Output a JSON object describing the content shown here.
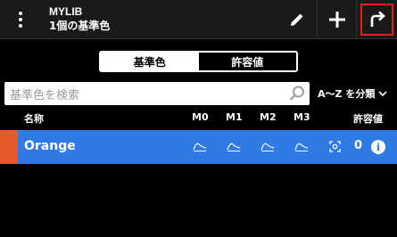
{
  "header": {
    "library": "MYLIB",
    "subtitle": "1個の基準色"
  },
  "segments": {
    "standard": "基準色",
    "tolerance": "許容値",
    "selected": "standard"
  },
  "search": {
    "placeholder": "基準色を検索"
  },
  "sort": {
    "label": "A〜Z を分類"
  },
  "columns": {
    "name": "名称",
    "m0": "M0",
    "m1": "M1",
    "m2": "M2",
    "m3": "M3",
    "tolerance": "許容値"
  },
  "rows": [
    {
      "name": "Orange",
      "swatch_color": "#e8582a",
      "tolerance": "0"
    }
  ],
  "colors": {
    "accent": "#2f7ae5",
    "highlight": "#e02020"
  }
}
